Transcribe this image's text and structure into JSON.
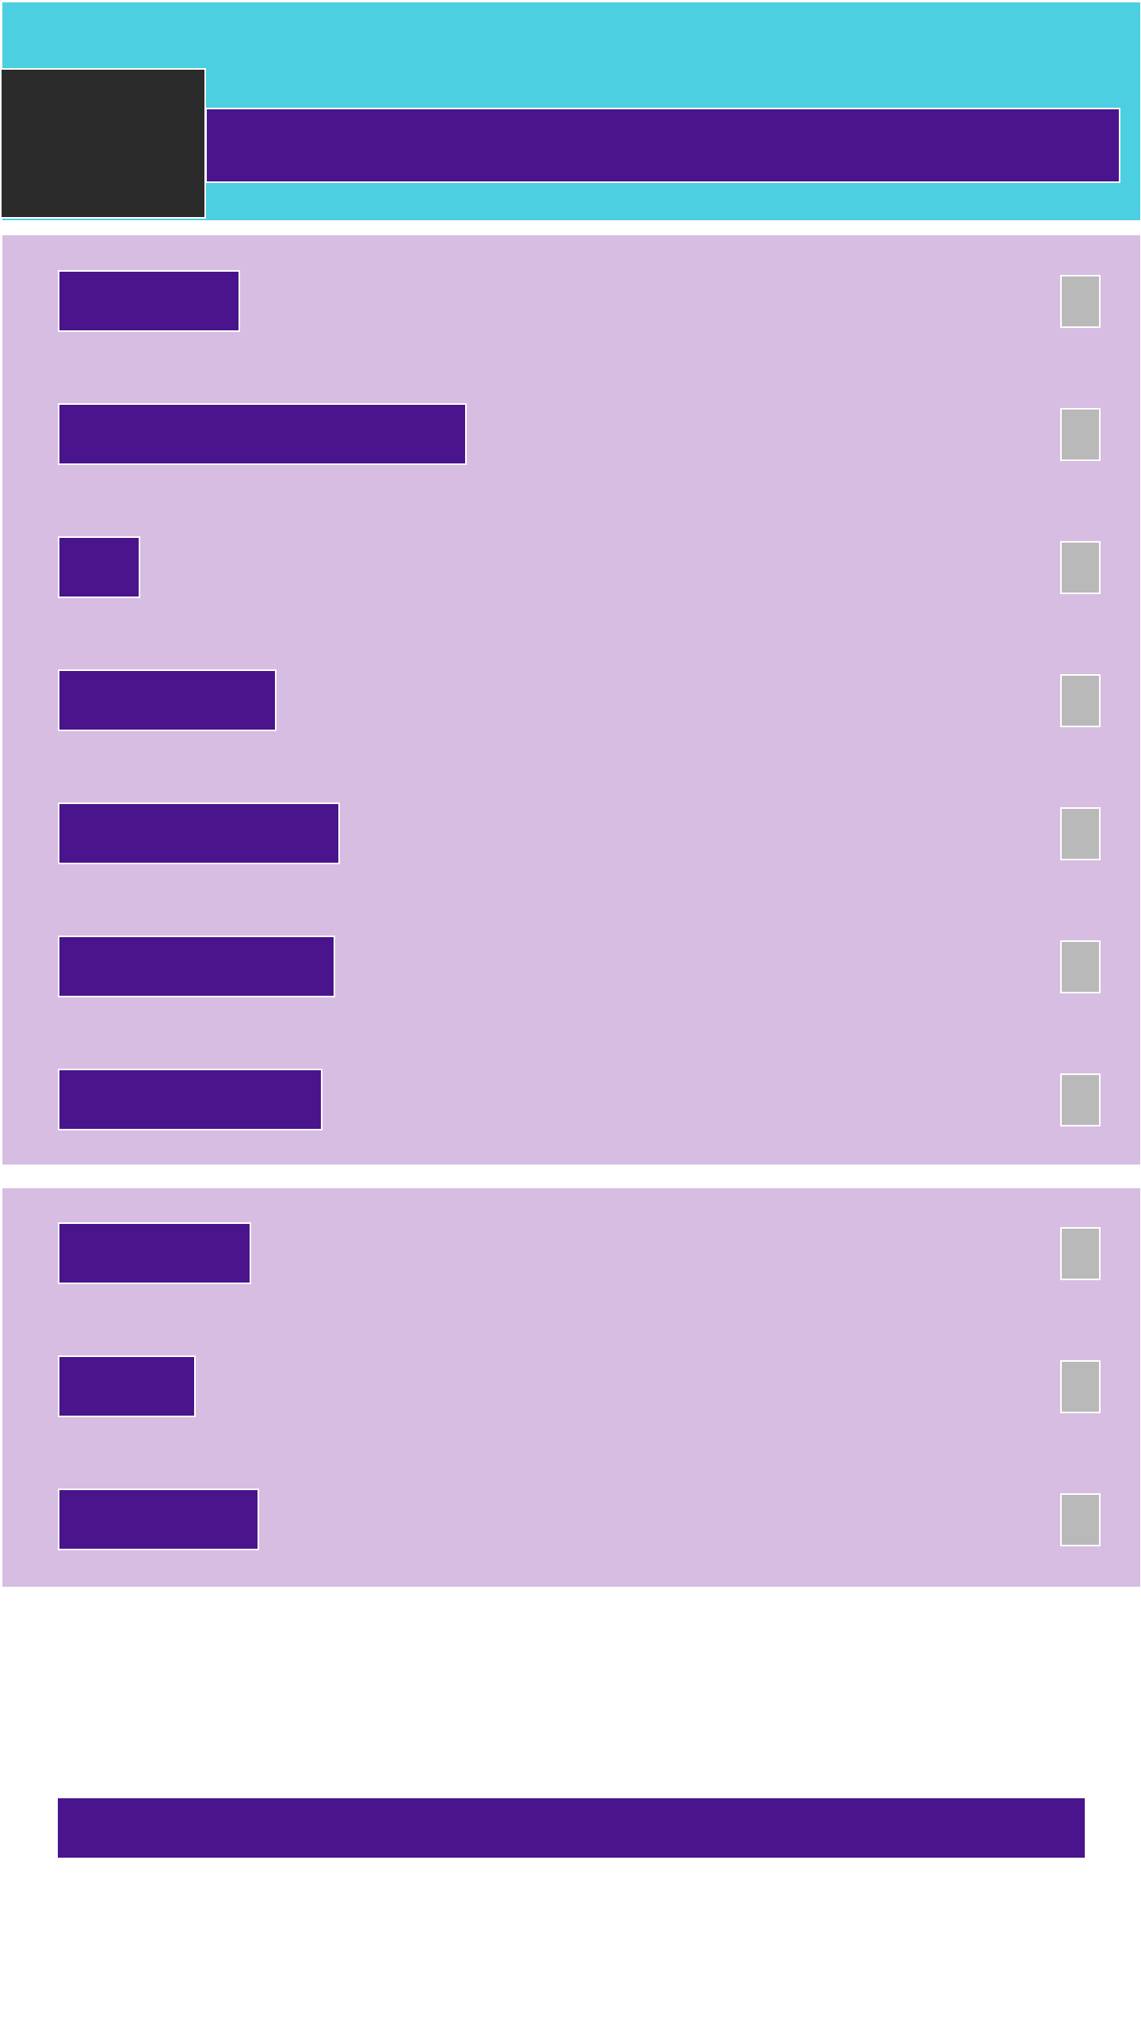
{
  "header": {
    "back_label": "",
    "title": ""
  },
  "section_1": {
    "rows": [
      {
        "label": ""
      },
      {
        "label": ""
      },
      {
        "label": ""
      },
      {
        "label": ""
      },
      {
        "label": ""
      },
      {
        "label": ""
      },
      {
        "label": ""
      }
    ]
  },
  "section_2": {
    "rows": [
      {
        "label": ""
      },
      {
        "label": ""
      },
      {
        "label": ""
      }
    ]
  },
  "footer": {
    "button_label": ""
  },
  "colors": {
    "header_bg": "#4ccfe0",
    "accent": "#4a148c",
    "panel_bg": "#d7bde2",
    "back_button_bg": "#2b2b2b",
    "checkbox_bg": "#b9b9b9"
  }
}
